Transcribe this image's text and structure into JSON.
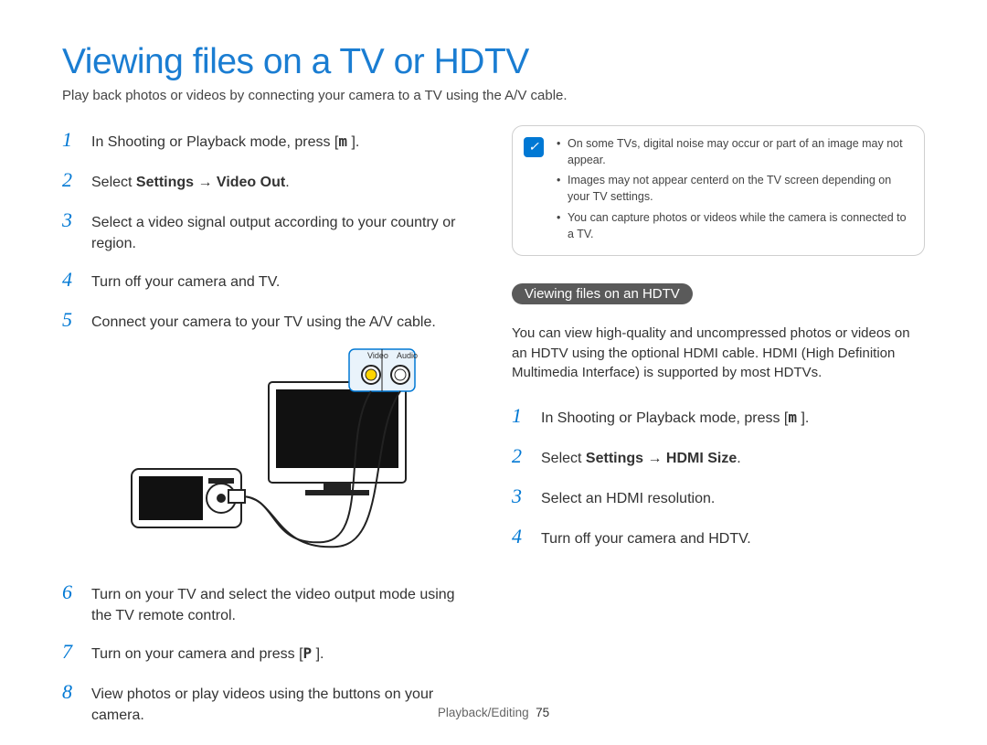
{
  "title": "Viewing files on a TV or HDTV",
  "intro": "Play back photos or videos by connecting your camera to a TV using the A/V cable.",
  "left_steps": [
    {
      "num": "1",
      "pre": "In Shooting or Playback mode, press [",
      "key": "m",
      "post": "      ]."
    },
    {
      "num": "2",
      "pre": "Select ",
      "bold": "Settings → Video Out",
      "post": "."
    },
    {
      "num": "3",
      "plain": "Select a video signal output according to your country or region."
    },
    {
      "num": "4",
      "plain": "Turn off your camera and TV."
    },
    {
      "num": "5",
      "plain": "Connect your camera to your TV using the A/V cable."
    },
    {
      "num": "6",
      "plain": "Turn on your TV and select the video output mode using the TV remote control."
    },
    {
      "num": "7",
      "pre": "Turn on your camera and press [",
      "key": "P",
      "post": "    ]."
    },
    {
      "num": "8",
      "plain": "View photos or play videos using the buttons on your camera."
    }
  ],
  "diagram_labels": {
    "video": "Video",
    "audio": "Audio"
  },
  "note_icon": "✓",
  "note_items": [
    "On some TVs, digital noise may occur or part of an image may not appear.",
    "Images may not appear centerd on the TV screen depending on your TV settings.",
    "You can capture photos or videos while the camera is connected to a TV."
  ],
  "section_heading": "Viewing files on an HDTV",
  "hdtv_intro": "You can view high-quality and uncompressed photos or videos on an HDTV using the optional HDMI cable. HDMI (High Definition Multimedia Interface) is supported by most HDTVs.",
  "right_steps": [
    {
      "num": "1",
      "pre": "In Shooting or Playback mode, press [",
      "key": "m",
      "post": "      ]."
    },
    {
      "num": "2",
      "pre": "Select ",
      "bold": "Settings → HDMI Size",
      "post": "."
    },
    {
      "num": "3",
      "plain": "Select an HDMI resolution."
    },
    {
      "num": "4",
      "plain": "Turn off your camera and HDTV."
    }
  ],
  "footer_section": "Playback/Editing",
  "footer_page": "75"
}
